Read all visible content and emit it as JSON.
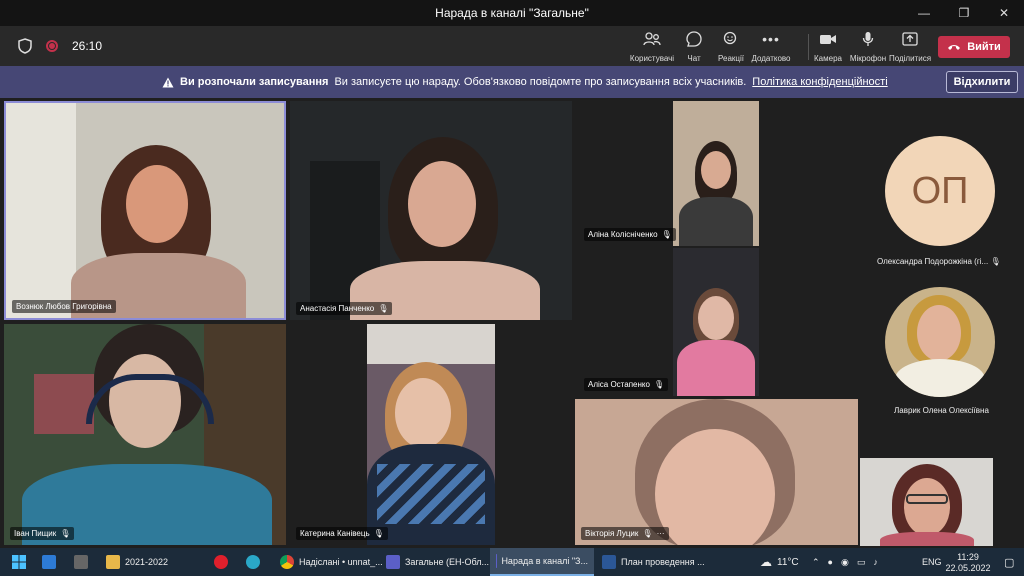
{
  "window": {
    "title": "Нарада в каналі \"Загальне\"",
    "controls": [
      "—",
      "❐",
      "✕"
    ]
  },
  "toolbar": {
    "timer": "26:10",
    "tools": [
      {
        "label": "Користувачі",
        "icon": "people-icon"
      },
      {
        "label": "Чат",
        "icon": "chat-icon"
      },
      {
        "label": "Реакції",
        "icon": "reactions-icon"
      },
      {
        "label": "Додатково",
        "icon": "more-icon"
      },
      {
        "label": "Камера",
        "icon": "camera-icon"
      },
      {
        "label": "Мікрофон",
        "icon": "microphone-icon"
      },
      {
        "label": "Поділитися",
        "icon": "share-icon"
      }
    ],
    "leave_label": "Вийти",
    "leave_color": "#c4314b"
  },
  "banner": {
    "title": "Ви розпочали записування",
    "message": "Ви записуєте цю нараду. Обов'язково повідомте про записування всіх учасників.",
    "link": "Політика конфіденційності",
    "dismiss": "Відхилити",
    "color": "#464775"
  },
  "participants": [
    {
      "name": "Вознюк Любов Григорівна",
      "muted": false
    },
    {
      "name": "Анастасія Панченко",
      "muted": true
    },
    {
      "name": "Аліна Колісніченко",
      "muted": true
    },
    {
      "name": "Аліса Остапенко",
      "muted": true
    },
    {
      "name": "Іван Пищик",
      "muted": true
    },
    {
      "name": "Катерина Канівець",
      "muted": true
    },
    {
      "name": "Вікторія Луцик",
      "muted": true,
      "more": "···"
    }
  ],
  "roster": [
    {
      "initials": "ОП",
      "name": "Олександра Подорожкіна (гі...",
      "muted": true
    },
    {
      "name": "Лаврик Олена Олексіївна",
      "muted": false
    }
  ],
  "taskbar": {
    "items": [
      {
        "label": "2021-2022"
      },
      {
        "label": "Надіслані • unnat_..."
      },
      {
        "label": "Загальне (ЕН-Обл..."
      },
      {
        "label": "Нарада в каналі \"З..."
      },
      {
        "label": "План проведення ..."
      }
    ],
    "weather": "11°C",
    "lang": "ENG",
    "time": "11:29",
    "date": "22.05.2022"
  }
}
